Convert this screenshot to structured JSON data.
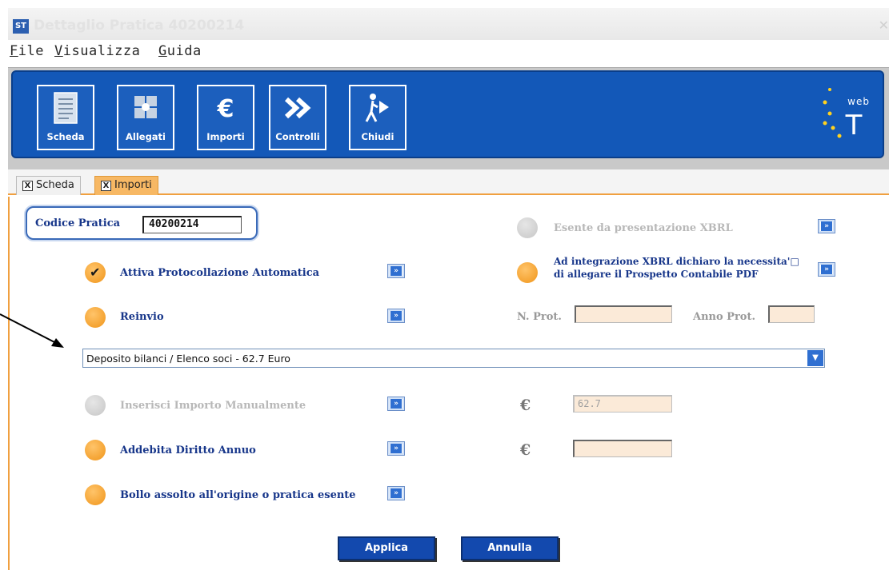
{
  "window": {
    "title": "Dettaglio Pratica 40200214",
    "icon_text": "ST"
  },
  "menu": {
    "items": [
      {
        "label": "File"
      },
      {
        "label": "Visualizza"
      },
      {
        "label": "Guida"
      }
    ]
  },
  "toolbar": {
    "buttons": [
      {
        "label": "Scheda",
        "icon": "document-icon"
      },
      {
        "label": "Allegati",
        "icon": "puzzle-icon"
      },
      {
        "label": "Importi",
        "icon": "euro-icon"
      },
      {
        "label": "Controlli",
        "icon": "double-chevron-icon"
      },
      {
        "label": "Chiudi",
        "icon": "exit-person-icon"
      }
    ],
    "logo_text": "web",
    "logo_letter": "T"
  },
  "tabs": [
    {
      "label": "Scheda",
      "active": false
    },
    {
      "label": "Importi",
      "active": true
    }
  ],
  "form": {
    "codice_label": "Codice Pratica",
    "codice_value": "40200214",
    "esente_label": "Esente da presentazione XBRL",
    "attiva_label": "Attiva Protocollazione Automatica",
    "integrazione_line1": "Ad integrazione XBRL dichiaro la necessita'□",
    "integrazione_line2": "di allegare il Prospetto Contabile PDF",
    "reinvio_label": "Reinvio",
    "nprot_label": "N. Prot.",
    "anno_label": "Anno Prot.",
    "nprot_value": "",
    "anno_value": "",
    "select_value": "Deposito bilanci / Elenco soci - 62.7 Euro",
    "inserisci_label": "Inserisci Importo Manualmente",
    "importo_value": "62.7",
    "addebita_label": "Addebita Diritto Annuo",
    "diritto_value": "",
    "bollo_label": "Bollo assolto all'origine o pratica esente",
    "euro_symbol": "€",
    "info_glyph": "»"
  },
  "actions": {
    "apply_label": "Applica",
    "cancel_label": "Annulla"
  },
  "colors": {
    "toolbar_blue": "#1358b8",
    "accent_orange": "#f0a040",
    "label_blue": "#17368a"
  }
}
